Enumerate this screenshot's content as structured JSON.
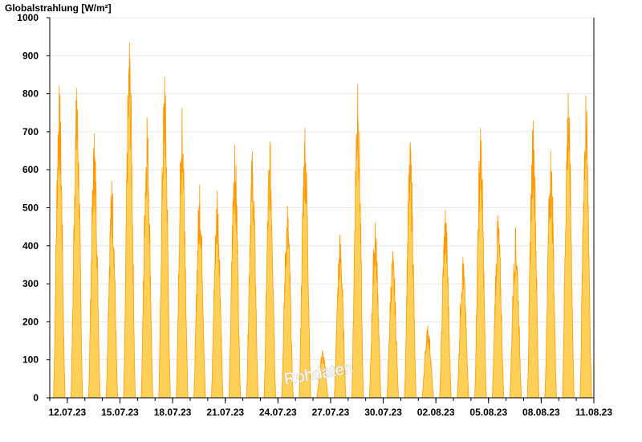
{
  "chart_data": {
    "type": "area",
    "title": "",
    "ylabel": "Globalstrahlung [W/m²]",
    "xlabel": "",
    "ylim": [
      0,
      1000
    ],
    "y_ticks": [
      0,
      100,
      200,
      300,
      400,
      500,
      600,
      700,
      800,
      900,
      1000
    ],
    "x_ticks": [
      "12.07.23",
      "15.07.23",
      "18.07.23",
      "21.07.23",
      "24.07.23",
      "27.07.23",
      "30.07.23",
      "02.08.23",
      "05.08.23",
      "08.08.23",
      "11.08.23"
    ],
    "x_range": [
      "11.07.23",
      "11.08.23"
    ],
    "grid": true,
    "fill_color": "#ffd057",
    "line_color": "#ff9900",
    "watermark": "Rohdaten",
    "series": [
      {
        "daily_peaks": [
          {
            "date": "11.07.23",
            "max": 820
          },
          {
            "date": "12.07.23",
            "max": 815
          },
          {
            "date": "13.07.23",
            "max": 695
          },
          {
            "date": "14.07.23",
            "max": 570
          },
          {
            "date": "15.07.23",
            "max": 935
          },
          {
            "date": "16.07.23",
            "max": 738
          },
          {
            "date": "17.07.23",
            "max": 845
          },
          {
            "date": "18.07.23",
            "max": 762
          },
          {
            "date": "19.07.23",
            "max": 560
          },
          {
            "date": "20.07.23",
            "max": 545
          },
          {
            "date": "21.07.23",
            "max": 665
          },
          {
            "date": "22.07.23",
            "max": 648
          },
          {
            "date": "23.07.23",
            "max": 675
          },
          {
            "date": "24.07.23",
            "max": 505
          },
          {
            "date": "25.07.23",
            "max": 710
          },
          {
            "date": "26.07.23",
            "max": 125
          },
          {
            "date": "27.07.23",
            "max": 430
          },
          {
            "date": "28.07.23",
            "max": 825
          },
          {
            "date": "29.07.23",
            "max": 460
          },
          {
            "date": "30.07.23",
            "max": 385
          },
          {
            "date": "31.07.23",
            "max": 672
          },
          {
            "date": "01.08.23",
            "max": 190
          },
          {
            "date": "02.08.23",
            "max": 495
          },
          {
            "date": "03.08.23",
            "max": 370
          },
          {
            "date": "04.08.23",
            "max": 710
          },
          {
            "date": "05.08.23",
            "max": 480
          },
          {
            "date": "06.08.23",
            "max": 448
          },
          {
            "date": "07.08.23",
            "max": 730
          },
          {
            "date": "08.08.23",
            "max": 650
          },
          {
            "date": "09.08.23",
            "max": 800
          },
          {
            "date": "10.08.23",
            "max": 795
          }
        ]
      }
    ]
  }
}
